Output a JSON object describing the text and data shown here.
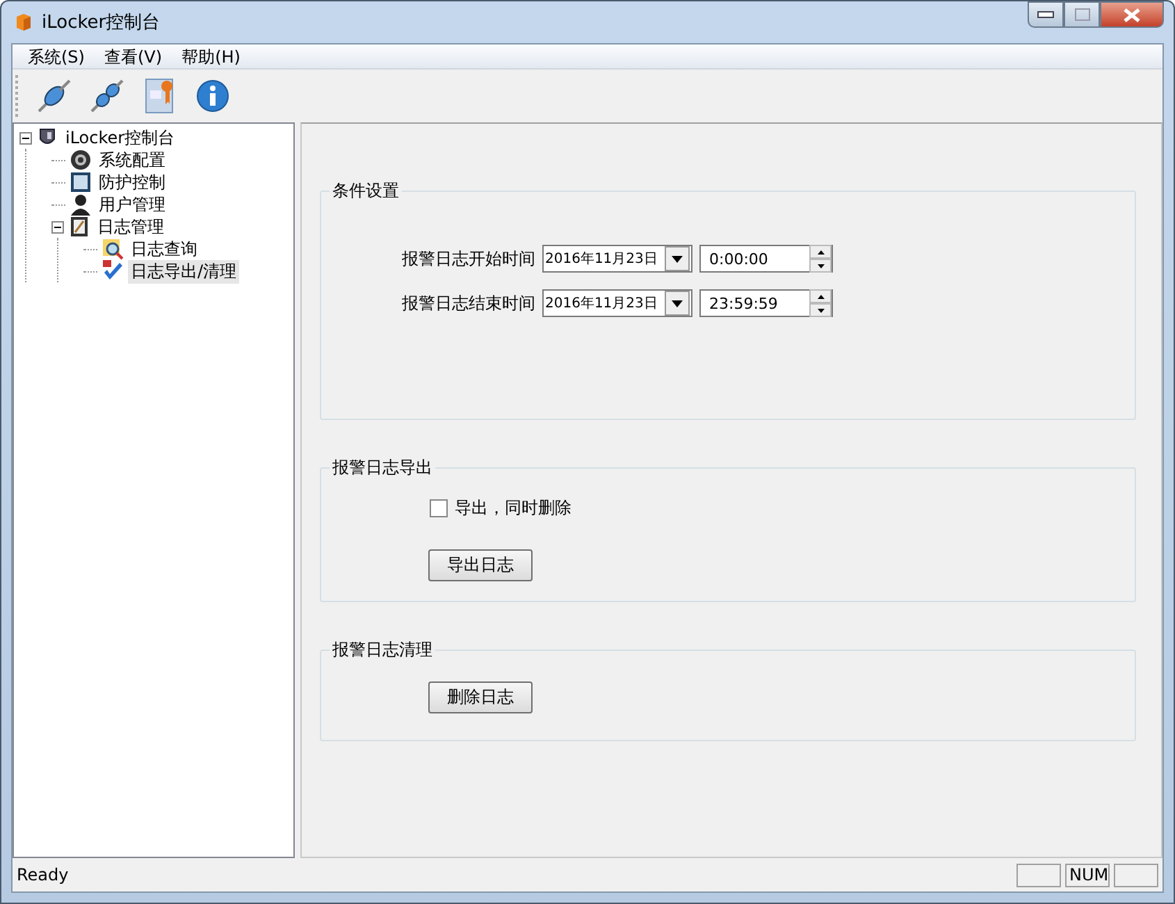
{
  "window": {
    "title": "iLocker控制台"
  },
  "menu": [
    {
      "label": "系统(S)"
    },
    {
      "label": "查看(V)"
    },
    {
      "label": "帮助(H)"
    }
  ],
  "toolbar": [
    {
      "kind": "connect"
    },
    {
      "kind": "disconnect"
    },
    {
      "kind": "certificate"
    },
    {
      "kind": "info"
    }
  ],
  "tree": [
    {
      "label": "iLocker控制台",
      "expanded": true,
      "selected": false,
      "children": [
        {
          "label": "系统配置",
          "selected": false
        },
        {
          "label": "防护控制",
          "selected": false
        },
        {
          "label": "用户管理",
          "selected": false
        },
        {
          "label": "日志管理",
          "expanded": true,
          "selected": false,
          "children": [
            {
              "label": "日志查询",
              "selected": false
            },
            {
              "label": "日志导出/清理",
              "selected": true
            }
          ]
        }
      ]
    }
  ],
  "condition_group": {
    "title": "条件设置",
    "rows": [
      {
        "label": "报警日志开始时间",
        "date": "2016年11月23日",
        "time": "0:00:00"
      },
      {
        "label": "报警日志结束时间",
        "date": "2016年11月23日",
        "time": "23:59:59"
      }
    ]
  },
  "export_group": {
    "title": "报警日志导出",
    "checkbox": {
      "label": "导出，同时删除",
      "checked": false
    },
    "button": "导出日志"
  },
  "clear_group": {
    "title": "报警日志清理",
    "button": "删除日志"
  },
  "status_bar": {
    "text": "Ready",
    "panes": [
      "NUM"
    ]
  }
}
